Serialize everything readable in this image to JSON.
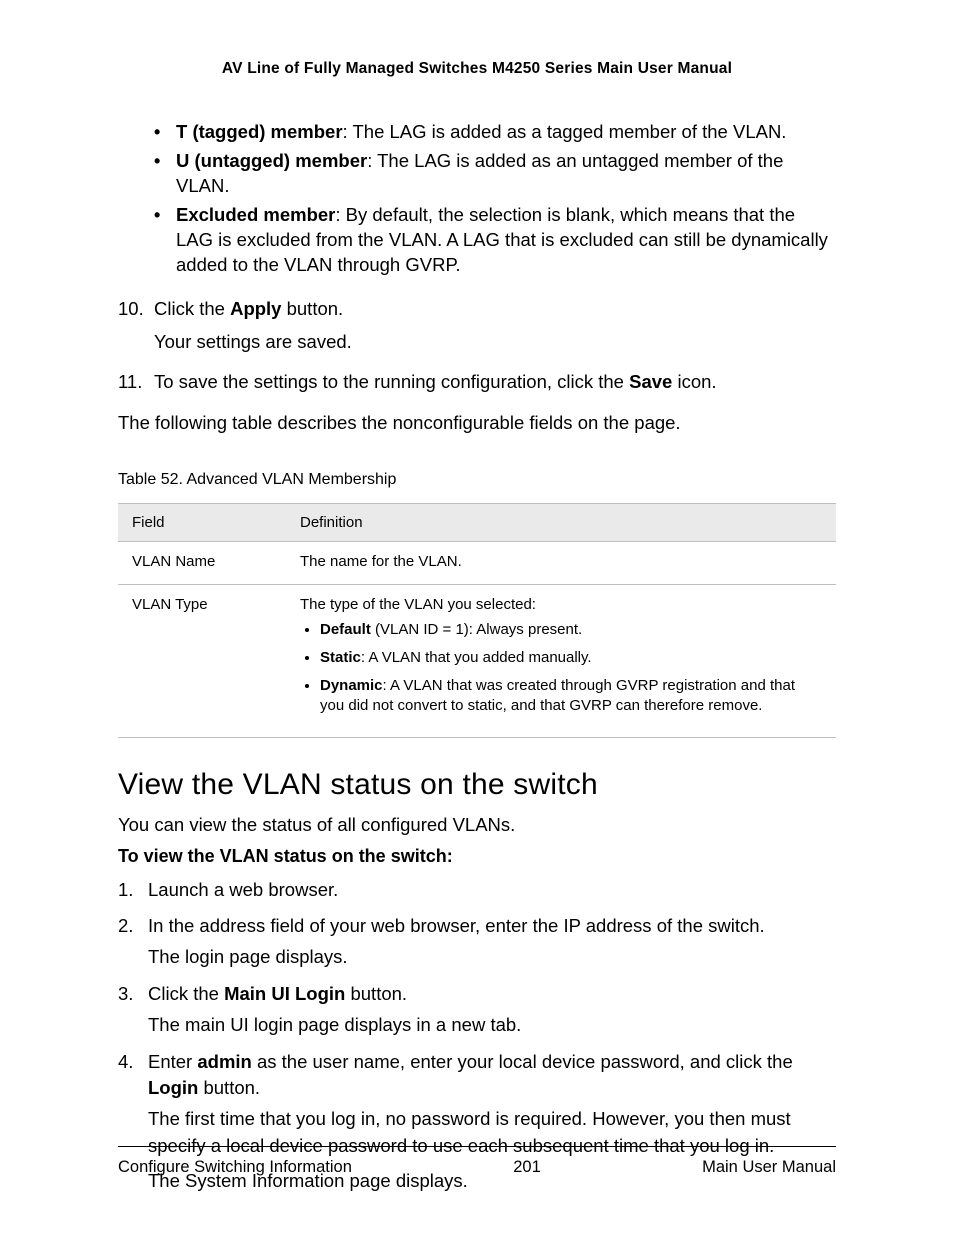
{
  "header": {
    "title": "AV Line of Fully Managed Switches M4250 Series Main User Manual"
  },
  "bullets": [
    {
      "prefix": "•",
      "bold": "T (tagged) member",
      "rest": ": The LAG is added as a tagged member of the VLAN."
    },
    {
      "prefix": "•",
      "bold": "U (untagged) member",
      "rest": ": The LAG is added as an untagged member of the VLAN."
    },
    {
      "prefix": "•",
      "bold": "Excluded member",
      "rest": ": By default, the selection is blank, which means that the LAG is excluded from the VLAN. A LAG that is excluded can still be dynamically added to the VLAN through GVRP."
    }
  ],
  "step10": {
    "num": "10.",
    "pre": "Click the ",
    "bold": "Apply",
    "post": " button.",
    "sub": "Your settings are saved."
  },
  "step11": {
    "num": "11.",
    "pre": "To save the settings to the running configuration, click the ",
    "bold": "Save",
    "post": " icon."
  },
  "intro_para": "The following table describes the nonconfigurable fields on the page.",
  "table": {
    "caption": "Table 52. Advanced VLAN Membership",
    "head_field": "Field",
    "head_def": "Definition",
    "row1_field": "VLAN Name",
    "row1_def": "The name for the VLAN.",
    "row2_field": "VLAN Type",
    "row2_intro": "The type of the VLAN you selected:",
    "row2_b1_bold": "Default",
    "row2_b1_rest": " (VLAN ID = 1): Always present.",
    "row2_b2_bold": "Static",
    "row2_b2_rest": ": A VLAN that you added manually.",
    "row2_b3_bold": "Dynamic",
    "row2_b3_rest": ": A VLAN that was created through GVRP registration and that you did not convert to static, and that GVRP can therefore remove."
  },
  "section": {
    "heading": "View the VLAN status on the switch",
    "intro": "You can view the status of all configured VLANs.",
    "subhead": "To view the VLAN status on the switch:"
  },
  "steps2": {
    "s1": {
      "num": "1.",
      "text": "Launch a web browser."
    },
    "s2": {
      "num": "2.",
      "text": "In the address field of your web browser, enter the IP address of the switch.",
      "sub": "The login page displays."
    },
    "s3": {
      "num": "3.",
      "pre": "Click the ",
      "bold": "Main UI Login",
      "post": " button.",
      "sub": "The main UI login page displays in a new tab."
    },
    "s4": {
      "num": "4.",
      "pre": "Enter ",
      "bold1": "admin",
      "mid": " as the user name, enter your local device password, and click the ",
      "bold2": "Login",
      "post": " button.",
      "sub1": "The first time that you log in, no password is required. However, you then must specify a local device password to use each subsequent time that you log in.",
      "sub2": "The System Information page displays."
    }
  },
  "footer": {
    "left": "Configure Switching Information",
    "center": "201",
    "right": "Main User Manual"
  }
}
